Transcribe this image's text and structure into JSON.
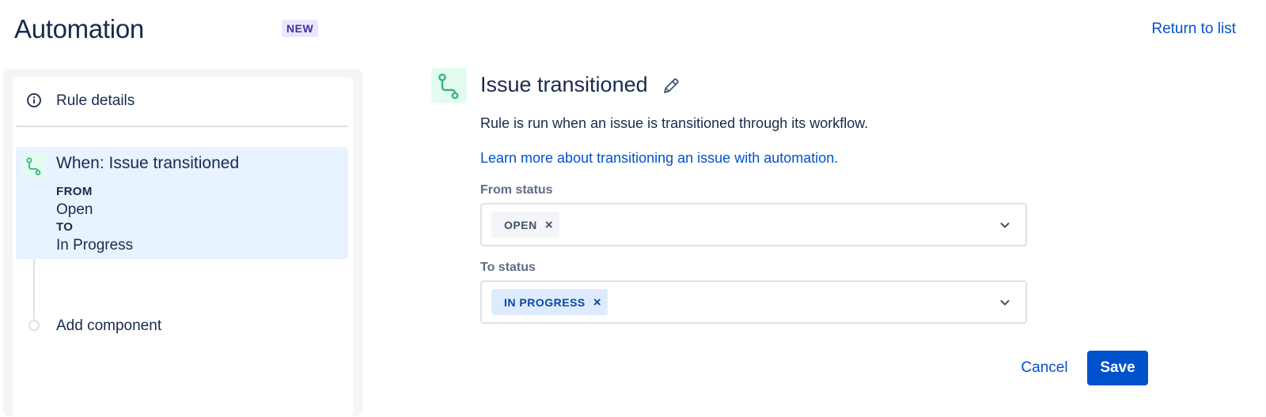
{
  "header": {
    "title": "Automation",
    "badge": "NEW",
    "return_link": "Return to list"
  },
  "sidebar": {
    "rule_details": {
      "label": "Rule details",
      "icon": "info-icon"
    },
    "trigger": {
      "icon": "transition-icon",
      "title": "When: Issue transitioned",
      "from_key": "FROM",
      "from_value": "Open",
      "to_key": "TO",
      "to_value": "In Progress"
    },
    "add_component": "Add component"
  },
  "main": {
    "icon": "transition-icon",
    "title": "Issue transitioned",
    "description": "Rule is run when an issue is transitioned through its workflow.",
    "learn_more": "Learn more about transitioning an issue with automation.",
    "from_status": {
      "label": "From status",
      "chips": [
        "OPEN"
      ]
    },
    "to_status": {
      "label": "To status",
      "chips": [
        "IN PROGRESS"
      ]
    },
    "remove_glyph": "×",
    "cancel_label": "Cancel",
    "save_label": "Save"
  },
  "colors": {
    "accent": "#0052cc",
    "icon_green": "#36b37e",
    "selected_bg": "#e9f2ff",
    "badge_bg": "#eae6ff",
    "badge_text": "#403294"
  }
}
